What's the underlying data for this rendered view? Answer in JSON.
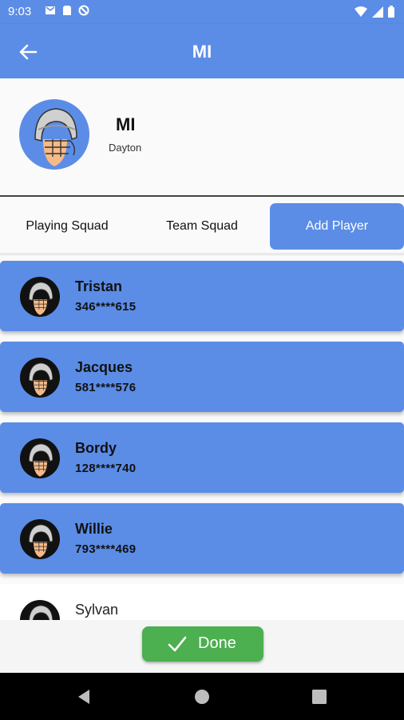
{
  "status_bar": {
    "time": "9:03",
    "left_icons": [
      "gmail-icon",
      "sim-icon",
      "no-sync-icon"
    ],
    "right_icons": [
      "wifi-icon",
      "signal-icon",
      "battery-icon"
    ]
  },
  "app_bar": {
    "title": "MI",
    "back_icon": "arrow-back-icon"
  },
  "team": {
    "name": "MI",
    "location": "Dayton"
  },
  "tabs": [
    {
      "label": "Playing Squad",
      "active": false
    },
    {
      "label": "Team Squad",
      "active": false
    },
    {
      "label": "Add Player",
      "active": true
    }
  ],
  "players": [
    {
      "name": "Tristan",
      "phone": "346****615"
    },
    {
      "name": "Jacques",
      "phone": "581****576"
    },
    {
      "name": "Bordy",
      "phone": "128****740"
    },
    {
      "name": "Willie",
      "phone": "793****469"
    },
    {
      "name": "Sylvan",
      "phone": ""
    }
  ],
  "done_button": {
    "label": "Done"
  },
  "colors": {
    "primary": "#5b8de6",
    "done": "#4caf50"
  }
}
